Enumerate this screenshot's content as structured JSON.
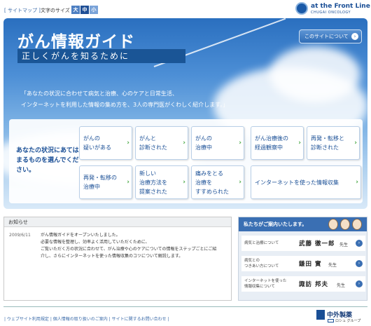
{
  "topbar": {
    "sitemap": "[ サイトマップ ]",
    "font_size_label": "文字のサイズ",
    "font_sizes": [
      "大",
      "中",
      "小"
    ]
  },
  "brand": {
    "name": "at the Front Line",
    "sub": "CHUGAI ONCOLOGY"
  },
  "hero": {
    "title": "がん情報ガイド",
    "subtitle": "正しくがんを知るために",
    "about_button": "このサイトについて",
    "intro_line1": "「あなたの状況に合わせて病気と治療、心のケアと日常生活、",
    "intro_line2": "インターネットを利用した情報の集め方を、3人の専門医がくわしく紹介します。」"
  },
  "panel": {
    "lead": "あなたの状況にあてはまるものを選んでください。",
    "choices_row1": [
      {
        "line1": "がんの",
        "line2": "疑いがある"
      },
      {
        "line1": "がんと",
        "line2": "診断された"
      },
      {
        "line1": "がんの",
        "line2": "治療中"
      },
      {
        "line1": "がん治療後の",
        "line2": "経過観察中"
      },
      {
        "line1": "再発・転移と",
        "line2": "診断された"
      }
    ],
    "choices_row2": [
      {
        "line1": "再発・転移の",
        "line2": "治療中"
      },
      {
        "line1": "新しい",
        "line2": "治療方法を",
        "line3": "提案された"
      },
      {
        "line1": "痛みをとる",
        "line2": "治療を",
        "line3": "すすめられた"
      },
      {
        "line1": "インターネットを使った情報収集"
      }
    ]
  },
  "notice": {
    "heading": "お知らせ",
    "date": "2009/6/11",
    "lines": [
      "がん情報ガイドをオープンいたしました。",
      "必要な情報を整理し、効率よく活用していただくために、",
      "ご覧いただく方の状況に合わせて、がん治療や心のケアについての情報をステップごとにご紹",
      "介し、さらにインターネットを使った情報収集のコツについて解説します。"
    ]
  },
  "guides": {
    "heading": "私たちがご案内いたします。",
    "rows": [
      {
        "topic1": "病気と治療について",
        "topic2": "",
        "name": "武藤 徹一郎",
        "suffix": "先生"
      },
      {
        "topic1": "病気との",
        "topic2": "つきあい方について",
        "name": "鎌田 實",
        "suffix": "先生"
      },
      {
        "topic1": "インターネットを使った",
        "topic2": "情報収集について",
        "name": "諏訪 邦夫",
        "suffix": "先生"
      }
    ]
  },
  "footer": {
    "links": "| ウェブサイト利用規定 | 個人情報の取り扱いのご案内 | サイトに関するお問い合わせ |",
    "company": "中外製薬",
    "group": "ロシュ グループ"
  },
  "colors": {
    "accent": "#1a4f96",
    "arrow_green": "#3fa33a"
  }
}
